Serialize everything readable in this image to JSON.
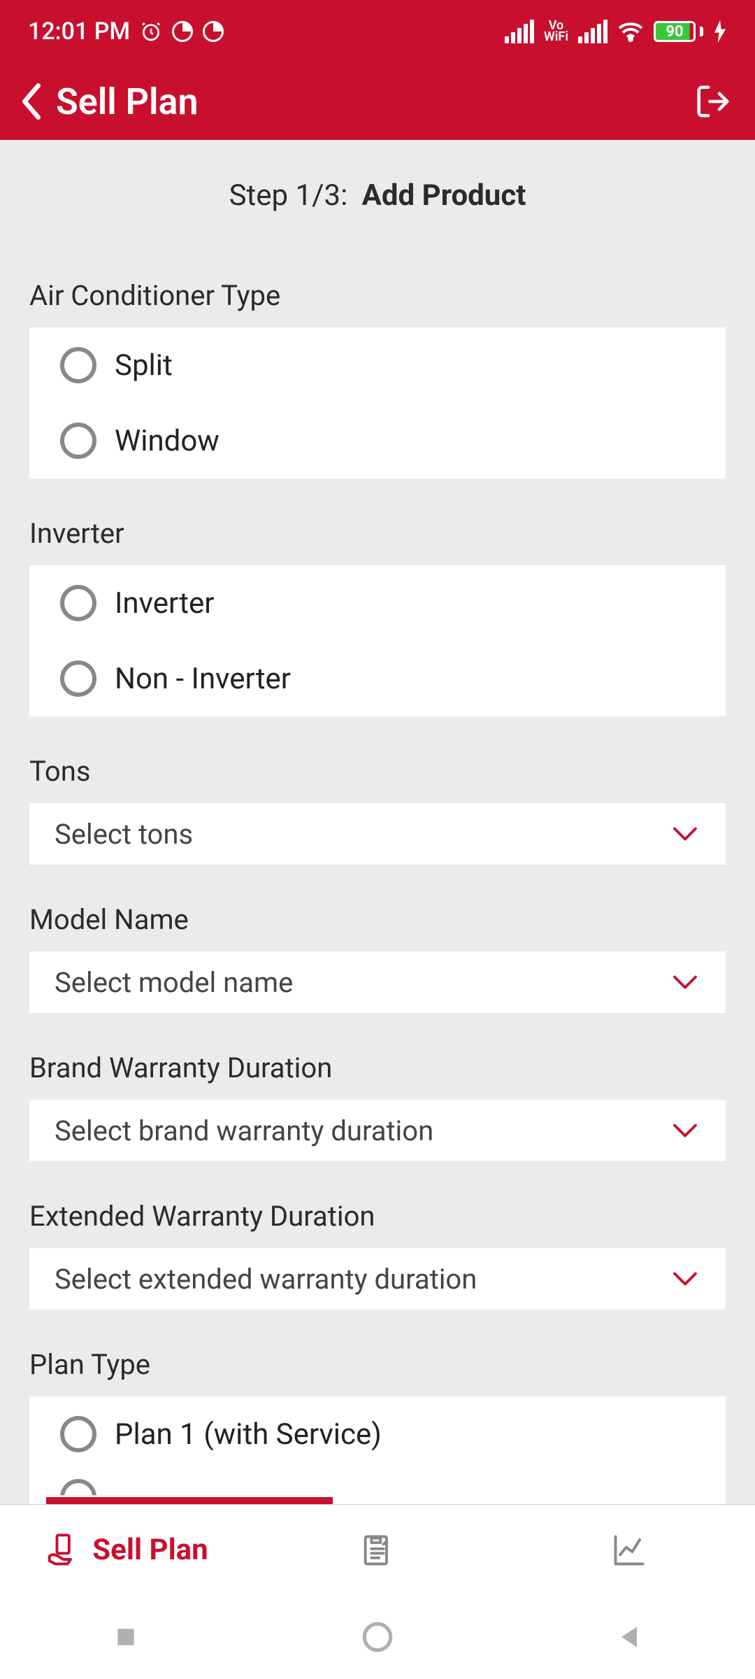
{
  "statusbar": {
    "time": "12:01 PM",
    "battery_pct": "90",
    "vo_label": "Vo",
    "wifi_label": "WiFi"
  },
  "appbar": {
    "title": "Sell Plan"
  },
  "step": {
    "prefix": "Step 1/3:",
    "title": "Add Product"
  },
  "sections": {
    "ac_type": {
      "label": "Air Conditioner Type",
      "options": [
        "Split",
        "Window"
      ]
    },
    "inverter": {
      "label": "Inverter",
      "options": [
        "Inverter",
        "Non - Inverter"
      ]
    },
    "tons": {
      "label": "Tons",
      "placeholder": "Select tons"
    },
    "model": {
      "label": "Model Name",
      "placeholder": "Select model name"
    },
    "brand_warranty": {
      "label": "Brand Warranty Duration",
      "placeholder": "Select brand warranty duration"
    },
    "ext_warranty": {
      "label": "Extended Warranty Duration",
      "placeholder": "Select extended warranty duration"
    },
    "plan_type": {
      "label": "Plan Type",
      "options": [
        "Plan 1 (with Service)"
      ]
    }
  },
  "bottomnav": {
    "sell_plan": "Sell Plan"
  }
}
